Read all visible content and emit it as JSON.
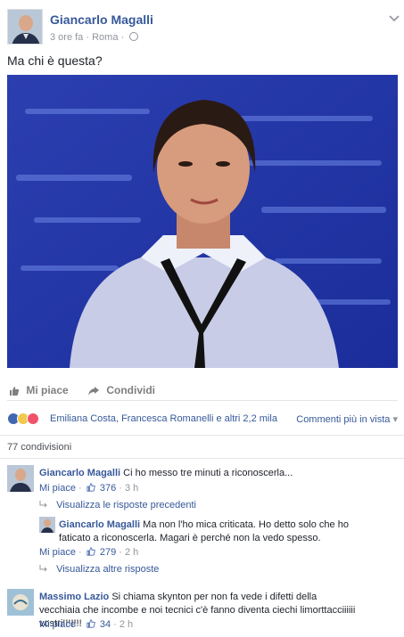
{
  "post": {
    "author": "Giancarlo Magalli",
    "time": "3 ore fa",
    "separator": "·",
    "location": "Roma",
    "text": "Ma chi è questa?"
  },
  "actions": {
    "like": "Mi piace",
    "share": "Condividi"
  },
  "reactions": {
    "names": "Emiliana Costa, Francesca Romanelli e altri 2,2 mila",
    "comments_order": "Commenti più in vista",
    "comments_order_arrow": "▾",
    "colors": {
      "like": "#4267b2",
      "haha": "#f2c94c",
      "love": "#f25268"
    }
  },
  "shares": "77 condivisioni",
  "comments": [
    {
      "author": "Giancarlo Magalli",
      "text": "Ci ho messo tre minuti a riconoscerla...",
      "like_label": "Mi piace",
      "likes": "376",
      "dot": "·",
      "time": "3 h"
    }
  ],
  "replies_prev": "Visualizza le risposte precedenti",
  "reply": {
    "author": "Giancarlo Magalli",
    "text": "Ma non l'ho mica criticata. Ho detto solo che ho faticato a riconoscerla. Magari è perché non la vedo spesso.",
    "like_label": "Mi piace",
    "likes": "279",
    "dot": "·",
    "time": "2 h"
  },
  "replies_more": "Visualizza altre risposte",
  "comment2": {
    "author": "Massimo Lazio",
    "text": "Si chiama skynton per non fa vede i difetti della vecchiaia che incombe e noi tecnici c'è fanno diventa ciechi limorttacciiiiii vostri!!!!!!!",
    "like_label": "Mi piace",
    "likes": "34",
    "dot": "·",
    "time": "2 h"
  }
}
